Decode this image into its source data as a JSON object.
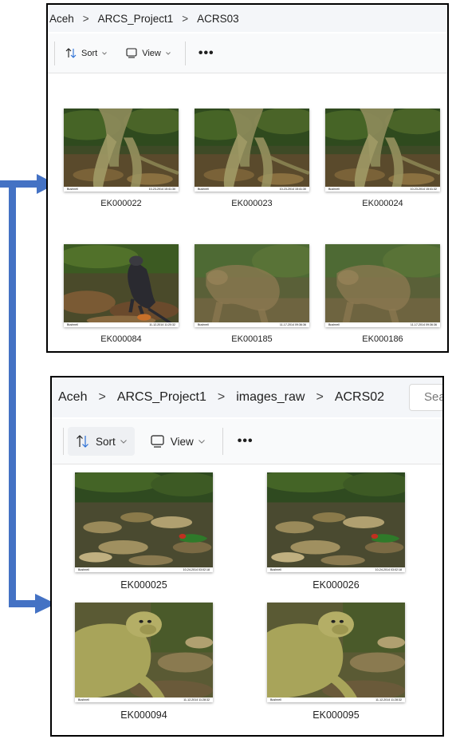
{
  "window_top": {
    "breadcrumb": [
      "Aceh",
      "ARCS_Project1",
      "ACRS03"
    ],
    "toolbar": {
      "sort_label": "Sort",
      "view_label": "View",
      "more_label": "•••"
    },
    "files": [
      {
        "name": "EK000022",
        "stamp": "10-23-2014 15:41:30",
        "scene": "monkey-legs"
      },
      {
        "name": "EK000023",
        "stamp": "10-23-2014 15:41:30",
        "scene": "monkey-legs"
      },
      {
        "name": "EK000024",
        "stamp": "10-23-2014 15:41:32",
        "scene": "monkey-legs"
      },
      {
        "name": "EK000084",
        "stamp": "11-12-2014 11:20:32",
        "scene": "langur"
      },
      {
        "name": "EK000185",
        "stamp": "11-17-2014 09:36:36",
        "scene": "blurred-monkey"
      },
      {
        "name": "EK000186",
        "stamp": "11-17-2014 09:36:36",
        "scene": "blurred-monkey"
      }
    ]
  },
  "window_bottom": {
    "breadcrumb": [
      "Aceh",
      "ARCS_Project1",
      "images_raw",
      "ACRS02"
    ],
    "search_placeholder": "Search",
    "toolbar": {
      "sort_label": "Sort",
      "view_label": "View",
      "more_label": "•••"
    },
    "files": [
      {
        "name": "EK000025",
        "stamp": "10-24-2014 03:02:18",
        "scene": "bird-litter"
      },
      {
        "name": "EK000026",
        "stamp": "10-24-2014 03:02:18",
        "scene": "bird-litter"
      },
      {
        "name": "EK000094",
        "stamp": "11-12-2014 11:28:32",
        "scene": "macaque"
      },
      {
        "name": "EK000095",
        "stamp": "11-12-2014 11:28:32",
        "scene": "macaque"
      }
    ]
  },
  "camera_brand": "Bushnell",
  "colors": {
    "arrow": "#4472c4",
    "window_border": "#000000"
  }
}
